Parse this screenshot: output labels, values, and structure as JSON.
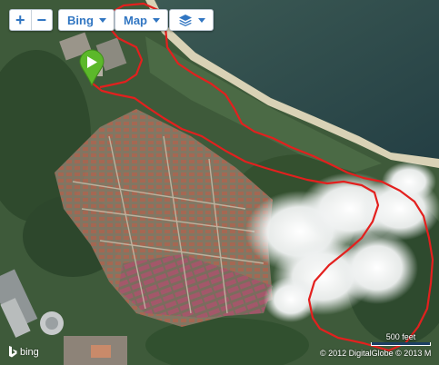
{
  "map": {
    "style": "satellite",
    "route_color": "#e3201e",
    "pin_color": "#5cb82a"
  },
  "controls": {
    "zoom_in": "+",
    "zoom_out": "−",
    "imagery_source": "Bing",
    "map_type": "Map",
    "layers_icon": "layers-icon"
  },
  "attribution": {
    "provider_logo": "bing",
    "copyright": "© 2012 DigitalGlobe  © 2013 M"
  },
  "scale_bar": {
    "label": "500 feet"
  }
}
